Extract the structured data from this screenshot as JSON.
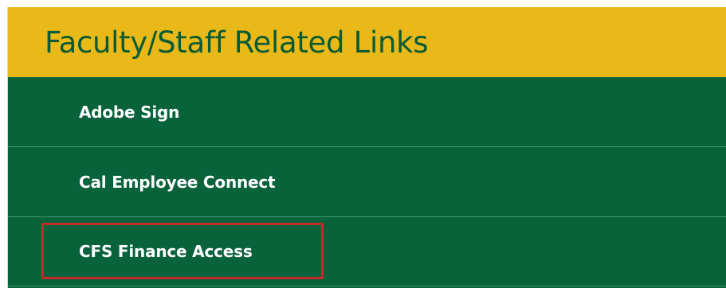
{
  "panel": {
    "title": "Faculty/Staff Related Links",
    "links": [
      {
        "label": "Adobe Sign"
      },
      {
        "label": "Cal Employee Connect"
      },
      {
        "label": "CFS Finance Access",
        "highlighted": true
      }
    ]
  },
  "colors": {
    "header_bg": "#e9b919",
    "header_text": "#0b5a33",
    "list_bg": "#08623a",
    "divider": "#3d9a6b",
    "link_text": "#ffffff",
    "highlight_border": "#c72a2a"
  }
}
